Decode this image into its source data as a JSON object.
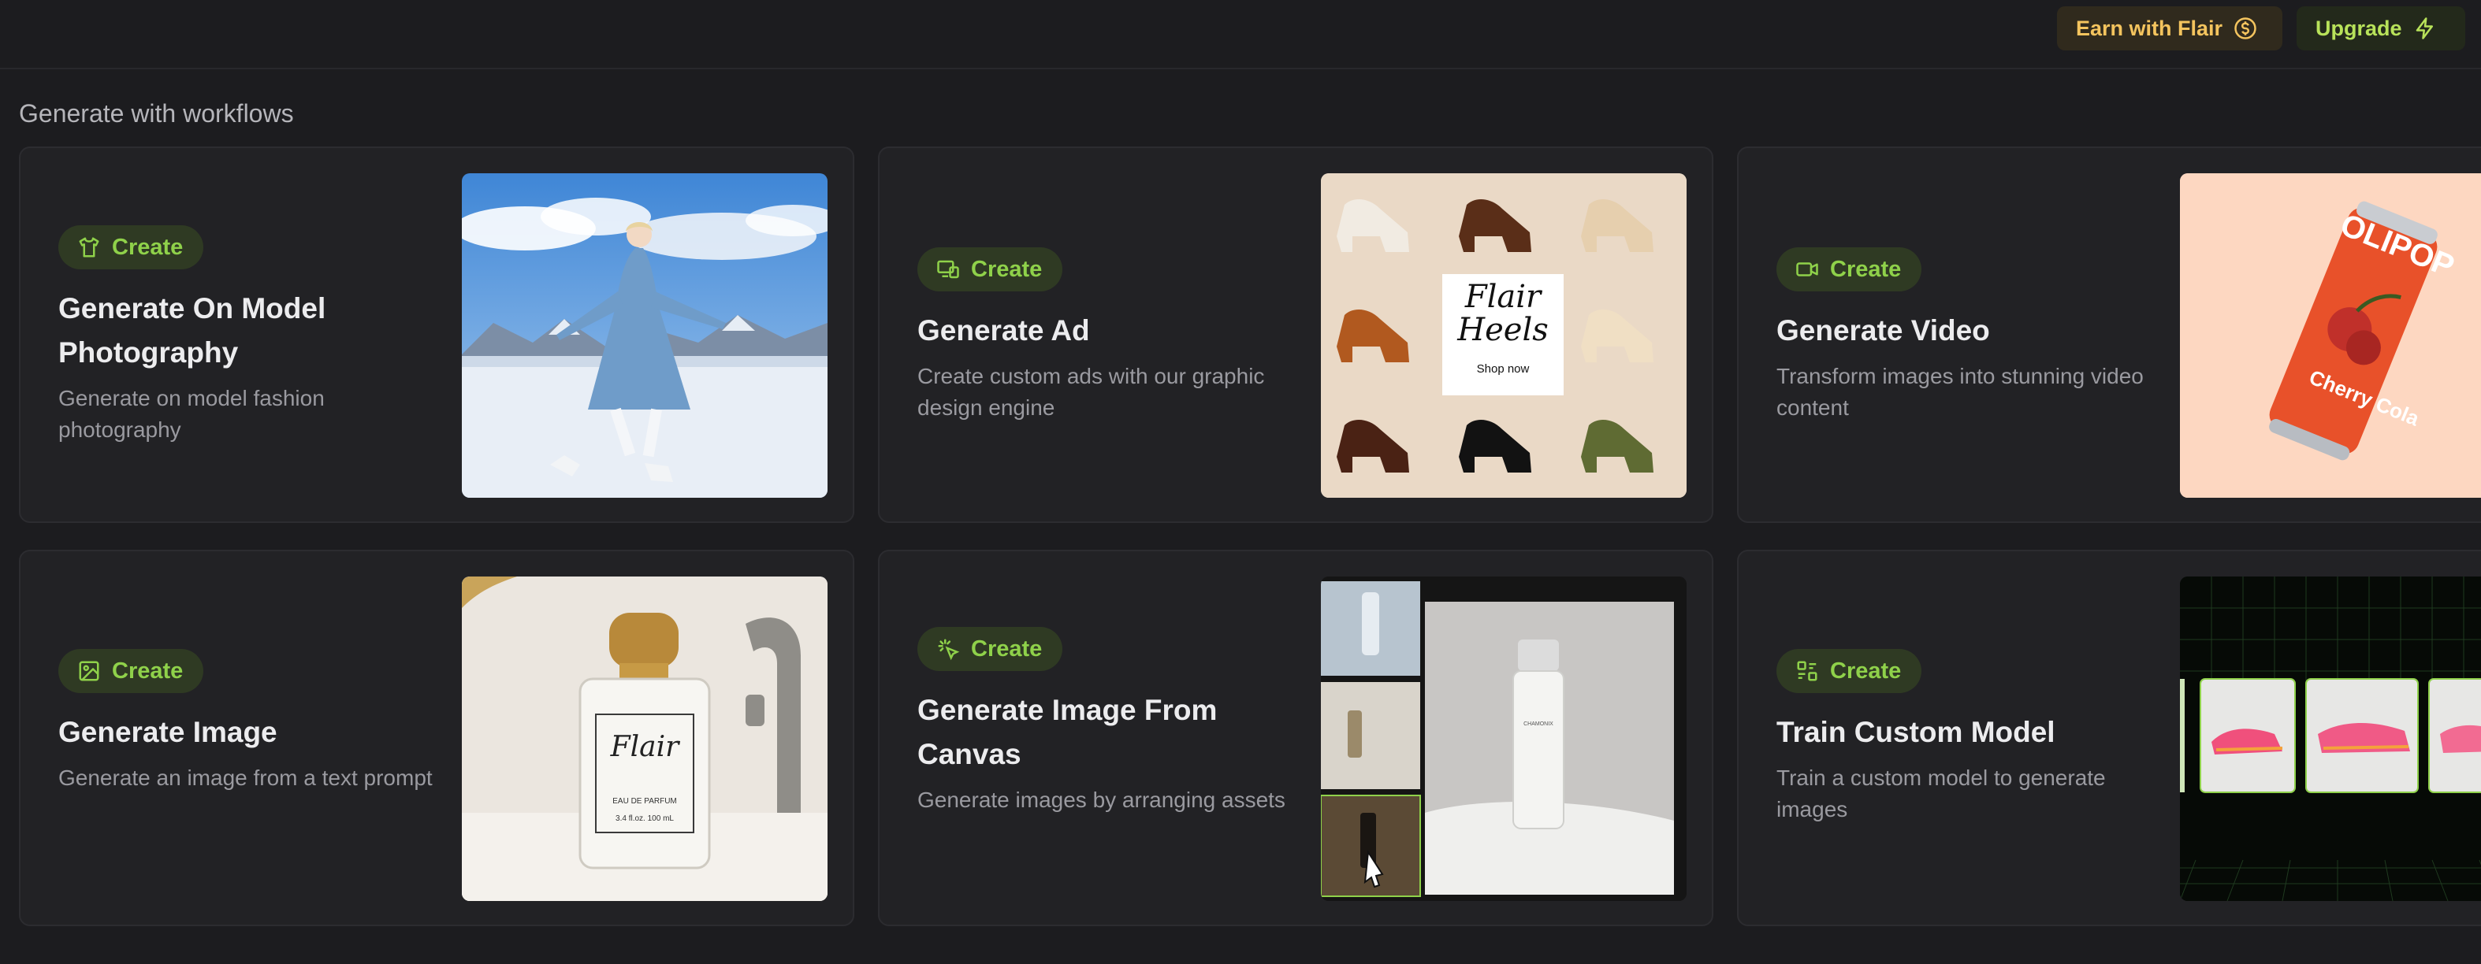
{
  "topbar": {
    "earn_label": "Earn with Flair",
    "upgrade_label": "Upgrade"
  },
  "section": {
    "title": "Generate with workflows"
  },
  "cards": [
    {
      "badge": "Create",
      "badge_icon": "shirt-icon",
      "title": "Generate On Model Photography",
      "desc": "Generate on model fashion photography"
    },
    {
      "badge": "Create",
      "badge_icon": "ad-devices-icon",
      "title": "Generate Ad",
      "desc": "Create custom ads with our graphic design engine"
    },
    {
      "badge": "Create",
      "badge_icon": "video-camera-icon",
      "title": "Generate Video",
      "desc": "Transform images into stunning video content"
    },
    {
      "badge": "Create",
      "badge_icon": "image-icon",
      "title": "Generate Image",
      "desc": "Generate an image from a text prompt"
    },
    {
      "badge": "Create",
      "badge_icon": "sparkle-cursor-icon",
      "title": "Generate Image From Canvas",
      "desc": "Generate images by arranging assets"
    },
    {
      "badge": "Create",
      "badge_icon": "model-icon",
      "title": "Train Custom Model",
      "desc": "Train a custom model to generate images"
    }
  ],
  "thumbnails": {
    "ad": {
      "brand_line1": "Flair",
      "brand_line2": "Heels",
      "cta": "Shop now"
    },
    "perfume": {
      "brand": "Flair",
      "sub": "EAU DE PARFUM",
      "size": "3.4 fl.oz. 100 mL"
    },
    "soda": {
      "brand": "OLIPOP",
      "flavor": "Cherry Cola"
    },
    "canvas": {
      "brand": "CHAMONIX"
    }
  },
  "colors": {
    "accent_green": "#8fd14a",
    "earn_gold": "#f4c45e",
    "upgrade_green": "#b8e25a",
    "background": "#1c1c1f"
  }
}
